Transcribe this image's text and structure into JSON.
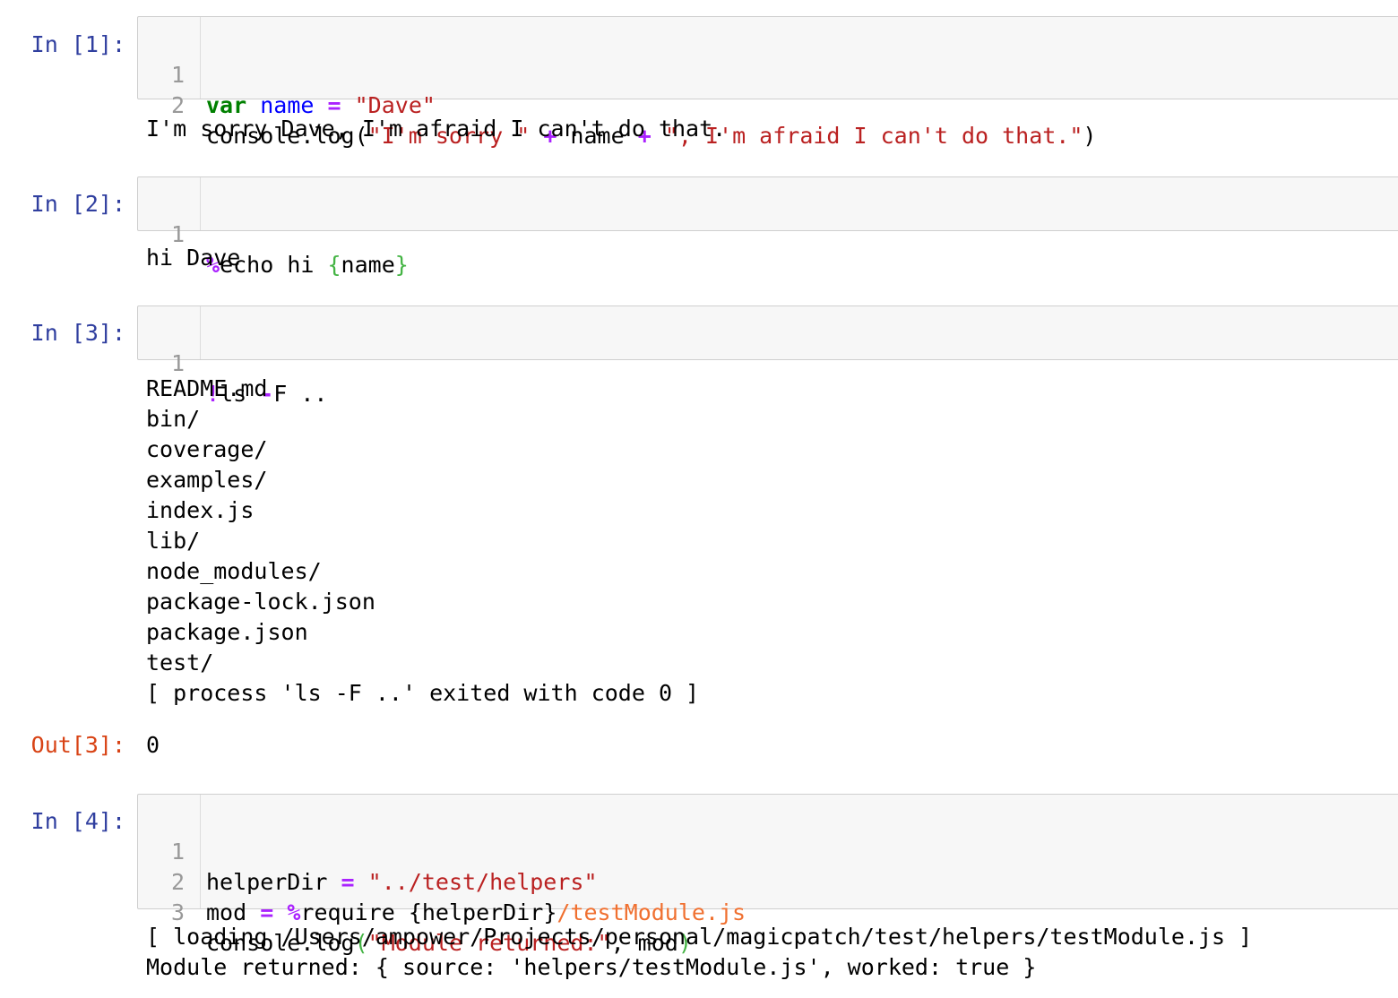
{
  "cells": [
    {
      "prompt": "In [1]:",
      "lines": [
        {
          "no": "1",
          "tokens": [
            {
              "t": "var",
              "c": "kw"
            },
            {
              "t": " ",
              "c": "plain"
            },
            {
              "t": "name",
              "c": "def"
            },
            {
              "t": " ",
              "c": "plain"
            },
            {
              "t": "=",
              "c": "op"
            },
            {
              "t": " ",
              "c": "plain"
            },
            {
              "t": "\"Dave\"",
              "c": "str"
            }
          ]
        },
        {
          "no": "2",
          "tokens": [
            {
              "t": "console.log(",
              "c": "plain"
            },
            {
              "t": "\"I'm sorry \"",
              "c": "str"
            },
            {
              "t": " ",
              "c": "plain"
            },
            {
              "t": "+",
              "c": "op"
            },
            {
              "t": " name ",
              "c": "plain"
            },
            {
              "t": "+",
              "c": "op"
            },
            {
              "t": " ",
              "c": "plain"
            },
            {
              "t": "\", I'm afraid I can't do that.\"",
              "c": "str"
            },
            {
              "t": ")",
              "c": "plain"
            }
          ]
        }
      ],
      "output": [
        "I'm sorry Dave, I'm afraid I can't do that."
      ]
    },
    {
      "prompt": "In [2]:",
      "lines": [
        {
          "no": "1",
          "tokens": [
            {
              "t": "%",
              "c": "op"
            },
            {
              "t": "echo hi ",
              "c": "plain"
            },
            {
              "t": "{",
              "c": "brace"
            },
            {
              "t": "name",
              "c": "plain"
            },
            {
              "t": "}",
              "c": "brace"
            }
          ]
        }
      ],
      "output": [
        "hi Dave"
      ]
    },
    {
      "prompt": "In [3]:",
      "lines": [
        {
          "no": "1",
          "tokens": [
            {
              "t": "!",
              "c": "op"
            },
            {
              "t": "ls ",
              "c": "plain"
            },
            {
              "t": "-",
              "c": "op"
            },
            {
              "t": "F ..",
              "c": "plain"
            }
          ]
        }
      ],
      "output": [
        "README.md",
        "bin/",
        "coverage/",
        "examples/",
        "index.js",
        "lib/",
        "node_modules/",
        "package-lock.json",
        "package.json",
        "test/",
        "[ process 'ls -F ..' exited with code 0 ]"
      ],
      "out_prompt": "Out[3]:",
      "out_value": "0"
    },
    {
      "prompt": "In [4]:",
      "lines": [
        {
          "no": "1",
          "tokens": [
            {
              "t": "helperDir ",
              "c": "plain"
            },
            {
              "t": "=",
              "c": "op"
            },
            {
              "t": " ",
              "c": "plain"
            },
            {
              "t": "\"../test/helpers\"",
              "c": "str"
            }
          ]
        },
        {
          "no": "2",
          "tokens": [
            {
              "t": "mod ",
              "c": "plain"
            },
            {
              "t": "=",
              "c": "op"
            },
            {
              "t": " ",
              "c": "plain"
            },
            {
              "t": "%",
              "c": "op"
            },
            {
              "t": "require {helperDir}",
              "c": "plain"
            },
            {
              "t": "/testModule.js",
              "c": "path"
            }
          ]
        },
        {
          "no": "3",
          "tokens": [
            {
              "t": "console.log",
              "c": "plain"
            },
            {
              "t": "(",
              "c": "paren"
            },
            {
              "t": "\"Module returned:\"",
              "c": "str"
            },
            {
              "t": ", mod",
              "c": "plain"
            },
            {
              "t": ")",
              "c": "paren"
            }
          ]
        }
      ],
      "output": [
        "[ loading /Users/ampower/Projects/personal/magicpatch/test/helpers/testModule.js ]",
        "Module returned: { source: 'helpers/testModule.js', worked: true }"
      ]
    }
  ]
}
